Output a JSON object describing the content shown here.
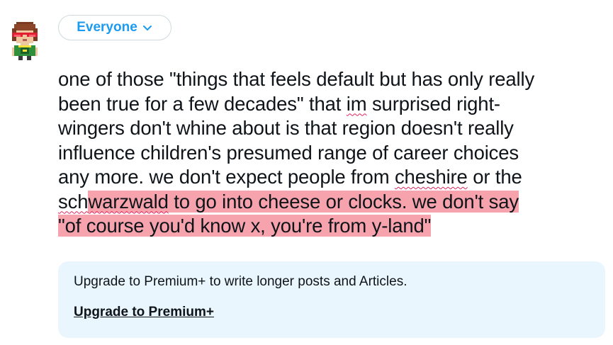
{
  "audience": {
    "label": "Everyone",
    "icon": "chevron-down-icon",
    "color": "#1d9bf0"
  },
  "avatar": {
    "icon": "pixel-art-avatar"
  },
  "post": {
    "lines": [
      {
        "segments": [
          {
            "text": "one of those \"things that feels default but has only really"
          }
        ]
      },
      {
        "segments": [
          {
            "text": "been true for a few decades\" that "
          },
          {
            "text": "im",
            "spell": true
          },
          {
            "text": " surprised right-"
          }
        ]
      },
      {
        "segments": [
          {
            "text": "wingers don't whine about is that region doesn't really"
          }
        ]
      },
      {
        "segments": [
          {
            "text": "influence children's presumed range of career choices"
          }
        ]
      },
      {
        "segments": [
          {
            "text": "any more. we don't expect people from "
          },
          {
            "text": "cheshire",
            "spell": true
          },
          {
            "text": " or the"
          }
        ]
      },
      {
        "segments": [
          {
            "text": "sch",
            "spell": true
          },
          {
            "text": "warzwald",
            "spell": true,
            "hl": true
          },
          {
            "text": " to go into cheese or clocks. we don't say",
            "hl": true
          }
        ]
      },
      {
        "segments": [
          {
            "text": "\"of course you'd know x, you're from y-land\"",
            "hl": true
          }
        ]
      }
    ],
    "highlight_color": "#f7a3ae",
    "spellcheck_color": "#e0245e"
  },
  "upsell": {
    "text": "Upgrade to Premium+ to write longer posts and Articles.",
    "link": "Upgrade to Premium+",
    "background": "#e9f6fd"
  }
}
